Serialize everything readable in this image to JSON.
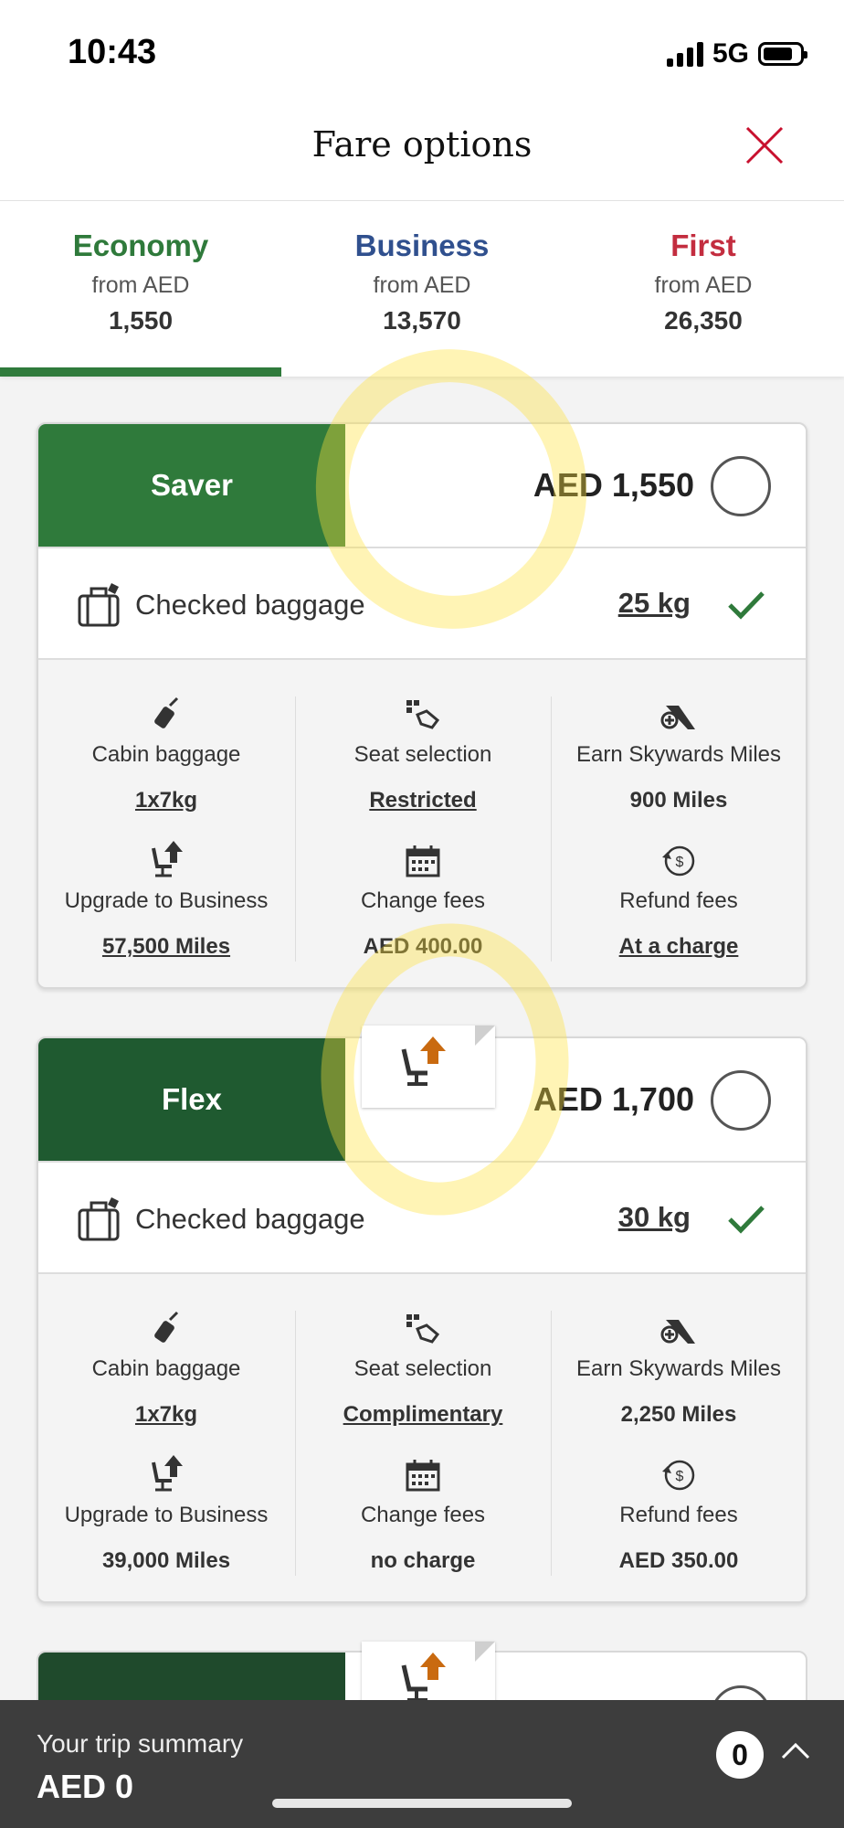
{
  "status_bar": {
    "time": "10:43",
    "network": "5G"
  },
  "header": {
    "title": "Fare options"
  },
  "tabs": [
    {
      "name": "Economy",
      "from": "from AED",
      "price": "1,550",
      "color": "#2f7a3b",
      "active": true
    },
    {
      "name": "Business",
      "from": "from AED",
      "price": "13,570",
      "color": "#30508e",
      "active": false
    },
    {
      "name": "First",
      "from": "from AED",
      "price": "26,350",
      "color": "#c32d3f",
      "active": false
    }
  ],
  "fares": [
    {
      "name": "Saver",
      "color": "#2f7a3b",
      "price": "AED 1,550",
      "checked_baggage": {
        "label": "Checked baggage",
        "value": "25 kg"
      },
      "features": [
        {
          "icon": "cabin-bag-icon",
          "label": "Cabin baggage",
          "value": "1x7kg"
        },
        {
          "icon": "seat-selection-icon",
          "label": "Seat selection",
          "value": "Restricted"
        },
        {
          "icon": "skywards-miles-icon",
          "label": "Earn Skywards Miles",
          "value": "900 Miles"
        },
        {
          "icon": "upgrade-seat-icon",
          "label": "Upgrade to Business",
          "value": "57,500 Miles"
        },
        {
          "icon": "calendar-icon",
          "label": "Change fees",
          "value": "AED 400.00"
        },
        {
          "icon": "refund-icon",
          "label": "Refund fees",
          "value": "At a charge"
        }
      ]
    },
    {
      "name": "Flex",
      "color": "#1f5a30",
      "price": "AED 1,700",
      "checked_baggage": {
        "label": "Checked baggage",
        "value": "30 kg"
      },
      "features": [
        {
          "icon": "cabin-bag-icon",
          "label": "Cabin baggage",
          "value": "1x7kg"
        },
        {
          "icon": "seat-selection-icon",
          "label": "Seat selection",
          "value": "Complimentary"
        },
        {
          "icon": "skywards-miles-icon",
          "label": "Earn Skywards Miles",
          "value": "2,250 Miles"
        },
        {
          "icon": "upgrade-seat-icon",
          "label": "Upgrade to Business",
          "value": "39,000 Miles"
        },
        {
          "icon": "calendar-icon",
          "label": "Change fees",
          "value": "no charge"
        },
        {
          "icon": "refund-icon",
          "label": "Refund fees",
          "value": "AED 350.00"
        }
      ]
    }
  ],
  "trip_summary": {
    "label": "Your trip summary",
    "value": "AED 0",
    "count": "0"
  }
}
